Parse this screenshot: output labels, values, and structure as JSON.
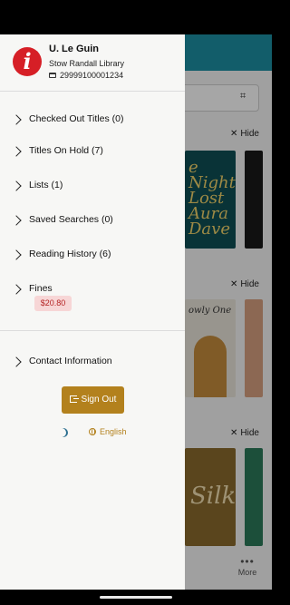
{
  "profile": {
    "name": "U. Le Guin",
    "library": "Stow Randall Library",
    "card_number": "29999100001234",
    "avatar_letter": "i"
  },
  "menu": [
    {
      "label": "Checked Out Titles (0)"
    },
    {
      "label": "Titles On Hold (7)"
    },
    {
      "label": "Lists (1)"
    },
    {
      "label": "Saved Searches (0)"
    },
    {
      "label": "Reading History (6)"
    },
    {
      "label": "Fines"
    },
    {
      "label": "Contact Information"
    }
  ],
  "fines_amount": "$20.80",
  "sign_out_label": "Sign Out",
  "language_label": "English",
  "background": {
    "hide_label": "Hide",
    "more_label": "More",
    "books": [
      {
        "text": "e Night\nLost\nAura\nDave"
      },
      {
        "text": "owly One"
      },
      {
        "text": "Silk"
      }
    ]
  },
  "colors": {
    "brand_teal": "#1c8fa3",
    "accent_gold": "#b3811d",
    "fine_red": "#b42323",
    "avatar_red": "#d61f26"
  },
  "icons": [
    "avatar-logo-icon",
    "card-icon",
    "chevron-right-icon",
    "sign-out-icon",
    "dark-mode-moon-icon",
    "globe-icon",
    "barcode-scan-icon",
    "close-icon",
    "more-dots-icon"
  ]
}
